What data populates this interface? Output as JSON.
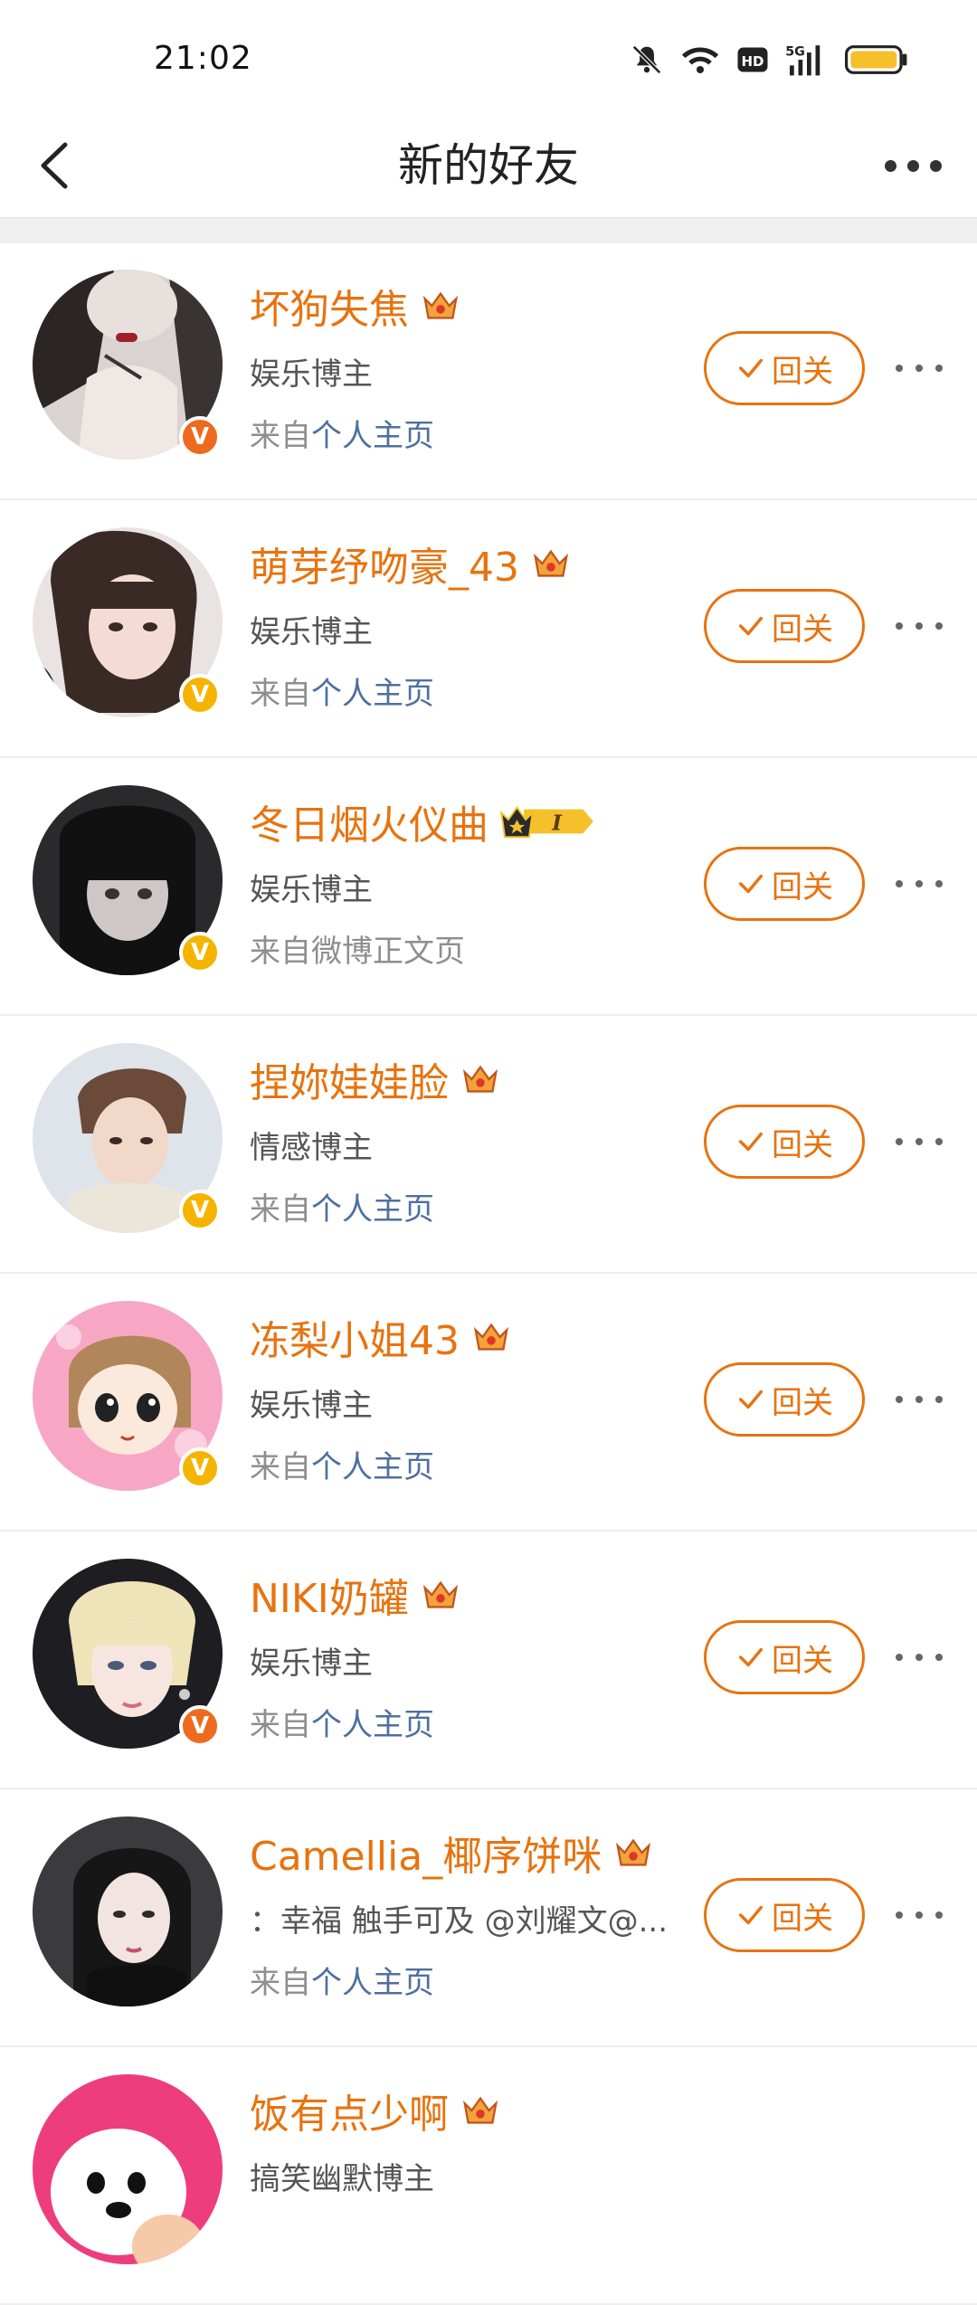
{
  "status": {
    "time": "21:02",
    "icons": [
      "bell-muted-icon",
      "wifi-icon",
      "hd-icon",
      "5g-signal-icon",
      "battery-icon"
    ]
  },
  "nav": {
    "title": "新的好友",
    "back_icon": "chevron-left-icon",
    "more_icon": "more-horizontal-icon"
  },
  "colors": {
    "accent": "#e7730f",
    "link": "#4f6f9f",
    "badge_orange": "#ee6a1e",
    "badge_yellow": "#f4b400"
  },
  "follow_label": "回关",
  "users": [
    {
      "name": "坏狗失焦",
      "subtitle": "娱乐博主",
      "source_prefix": "来自",
      "source_link": "个人主页",
      "badge": "V"
    },
    {
      "name": "萌芽纾吻豪_43",
      "subtitle": "娱乐博主",
      "source_prefix": "来自",
      "source_link": "个人主页",
      "badge": "V"
    },
    {
      "name": "冬日烟火仪曲",
      "subtitle": "娱乐博主",
      "source_prefix": "来自微博正文页",
      "source_link": "",
      "badge": "V",
      "rank": "I"
    },
    {
      "name": "捏妳娃娃脸",
      "subtitle": "情感博主",
      "source_prefix": "来自",
      "source_link": "个人主页",
      "badge": "V"
    },
    {
      "name": "冻梨小姐43",
      "subtitle": "娱乐博主",
      "source_prefix": "来自",
      "source_link": "个人主页",
      "badge": "V"
    },
    {
      "name": "NIKI奶罐",
      "subtitle": "娱乐博主",
      "source_prefix": "来自",
      "source_link": "个人主页",
      "badge": "V"
    },
    {
      "name": "Camellia_椰序饼咪",
      "subtitle": "：幸福 触手可及 @刘耀文@...",
      "source_prefix": "来自",
      "source_link": "个人主页",
      "badge": ""
    },
    {
      "name": "饭有点少啊",
      "subtitle": "搞笑幽默博主",
      "source_prefix": "",
      "source_link": "",
      "badge": ""
    }
  ]
}
